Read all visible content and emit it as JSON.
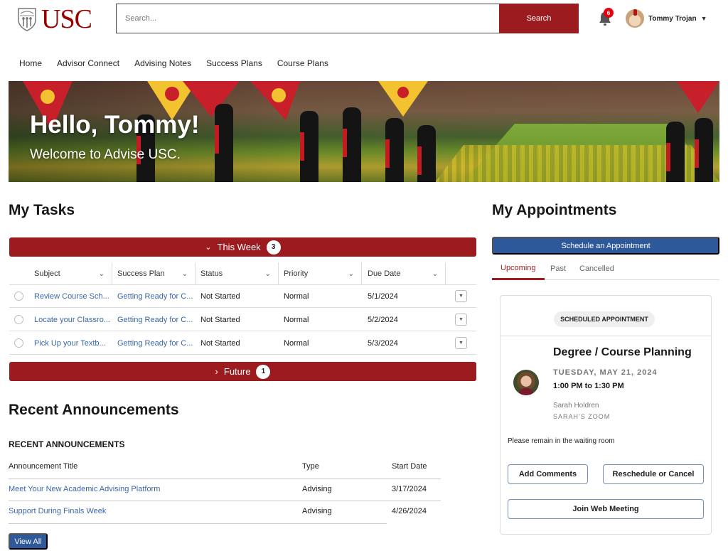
{
  "header": {
    "logo_text": "USC",
    "search_placeholder": "Search...",
    "search_button": "Search",
    "notification_count": "6",
    "user_name": "Tommy Trojan",
    "icons": {
      "logo": "usc-shield-icon",
      "bell": "bell-icon",
      "caret": "caret-down-icon"
    }
  },
  "nav": {
    "items": [
      {
        "label": "Home"
      },
      {
        "label": "Advisor Connect"
      },
      {
        "label": "Advising Notes"
      },
      {
        "label": "Success Plans"
      },
      {
        "label": "Course Plans"
      }
    ]
  },
  "hero": {
    "title": "Hello, Tommy!",
    "subtitle": "Welcome to Advise USC."
  },
  "tasks": {
    "title": "My Tasks",
    "this_week": {
      "label": "This Week",
      "count": "3"
    },
    "future": {
      "label": "Future",
      "count": "1"
    },
    "columns": [
      "Subject",
      "Success Plan",
      "Status",
      "Priority",
      "Due Date"
    ],
    "rows": [
      {
        "subject": "Review Course Sch...",
        "plan": "Getting Ready for C...",
        "status": "Not Started",
        "priority": "Normal",
        "due": "5/1/2024"
      },
      {
        "subject": "Locate your Classro...",
        "plan": "Getting Ready for C...",
        "status": "Not Started",
        "priority": "Normal",
        "due": "5/2/2024"
      },
      {
        "subject": "Pick Up your Textb...",
        "plan": "Getting Ready for C...",
        "status": "Not Started",
        "priority": "Normal",
        "due": "5/3/2024"
      }
    ]
  },
  "announcements": {
    "title": "Recent Announcements",
    "list_heading": "RECENT ANNOUNCEMENTS",
    "columns": [
      "Announcement Title",
      "Type",
      "Start Date"
    ],
    "rows": [
      {
        "title": "Meet Your New Academic Advising Platform",
        "type": "Advising",
        "date": "3/17/2024"
      },
      {
        "title": "Support During Finals Week",
        "type": "Advising",
        "date": "4/26/2024"
      }
    ],
    "view_all": "View All"
  },
  "appointments": {
    "title": "My Appointments",
    "schedule_button": "Schedule an Appointment",
    "tabs": [
      {
        "label": "Upcoming",
        "active": true
      },
      {
        "label": "Past",
        "active": false
      },
      {
        "label": "Cancelled",
        "active": false
      }
    ],
    "card": {
      "badge": "SCHEDULED APPOINTMENT",
      "title": "Degree / Course Planning",
      "date": "TUESDAY, MAY 21, 2024",
      "time": "1:00 PM to 1:30 PM",
      "advisor": "Sarah Holdren",
      "location": "SARAH'S ZOOM",
      "note": "Please remain in the waiting room",
      "add_comments": "Add Comments",
      "reschedule": "Reschedule or Cancel",
      "join": "Join Web Meeting"
    }
  },
  "colors": {
    "brand_red": "#9b1b1f",
    "button_blue": "#2d5899",
    "link_blue": "#3b67a8",
    "badge_red": "#e3000f"
  }
}
